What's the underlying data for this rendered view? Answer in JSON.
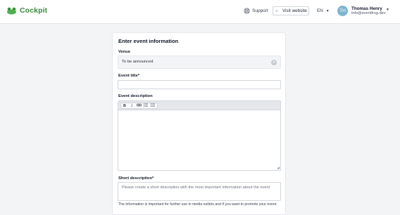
{
  "header": {
    "logo_text": "Cockpit",
    "support_label": "Support",
    "visit_label": "Visit website",
    "lang": "EN",
    "user": {
      "initials": "TH",
      "name": "Thomas Henry",
      "email": "info@eventfrog.dev"
    }
  },
  "form": {
    "title": "Enter event information",
    "venue_label": "Venue",
    "venue_value": "To be announced",
    "event_title_label": "Event title*",
    "event_title_value": "",
    "description_label": "Event description",
    "toolbar": [
      "B",
      "I",
      "link-icon",
      "bullet-list-icon",
      "numbered-list-icon"
    ],
    "short_description_label": "Short description*",
    "short_description_placeholder": "Please create a short description with the most important information about the event",
    "help_text": "The information is important for further use in media outlets and if you want to promote your event."
  },
  "colors": {
    "brand": "#3a8a3f",
    "avatar": "#7fb5cf",
    "background": "#f3f4f6"
  }
}
